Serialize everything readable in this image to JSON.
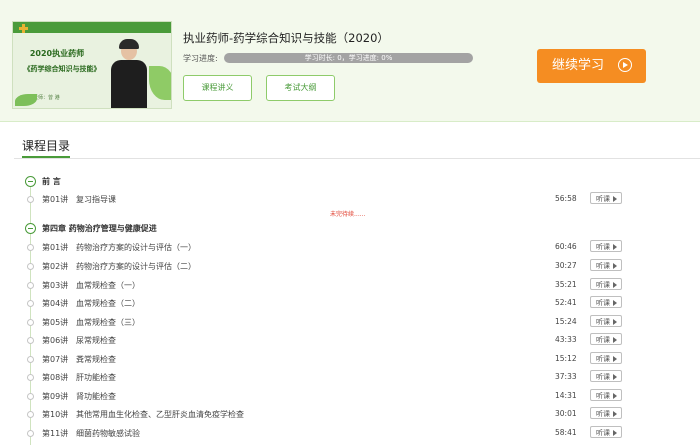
{
  "course": {
    "title": "执业药师-药学综合知识与技能（2020）",
    "progress_label": "学习进度:",
    "progress_text": "学习时长: 0，学习进度: 0%",
    "progress_percent": 0,
    "buttons": {
      "lectures": "课程讲义",
      "outline": "考试大纲"
    },
    "continue_label": "继续学习",
    "thumbnail": {
      "line1": "2020执业药师",
      "line2": "《药学综合知识与技能》",
      "line3": "主讲老师：曾 港"
    }
  },
  "catalog": {
    "title": "课程目录",
    "notice": "未完待续......",
    "listen_label": "听课",
    "chapters": [
      {
        "title": "前  言",
        "lectures": [
          {
            "num": "第01讲",
            "title": "复习指导课",
            "duration": "56:58"
          }
        ]
      },
      {
        "title": "第四章   药物治疗管理与健康促进",
        "lectures": [
          {
            "num": "第01讲",
            "title": "药物治疗方案的设计与评估（一）",
            "duration": "60:46"
          },
          {
            "num": "第02讲",
            "title": "药物治疗方案的设计与评估（二）",
            "duration": "30:27"
          },
          {
            "num": "第03讲",
            "title": "血常规检查（一）",
            "duration": "35:21"
          },
          {
            "num": "第04讲",
            "title": "血常规检查（二）",
            "duration": "52:41"
          },
          {
            "num": "第05讲",
            "title": "血常规检查（三）",
            "duration": "15:24"
          },
          {
            "num": "第06讲",
            "title": "尿常规检查",
            "duration": "43:33"
          },
          {
            "num": "第07讲",
            "title": "粪常规检查",
            "duration": "15:12"
          },
          {
            "num": "第08讲",
            "title": "肝功能检查",
            "duration": "37:33"
          },
          {
            "num": "第09讲",
            "title": "肾功能检查",
            "duration": "14:31"
          },
          {
            "num": "第10讲",
            "title": "其他常用血生化检查、乙型肝炎血清免疫学检查",
            "duration": "30:01"
          },
          {
            "num": "第11讲",
            "title": "细菌药物敏感试验",
            "duration": "58:41"
          }
        ]
      }
    ]
  }
}
